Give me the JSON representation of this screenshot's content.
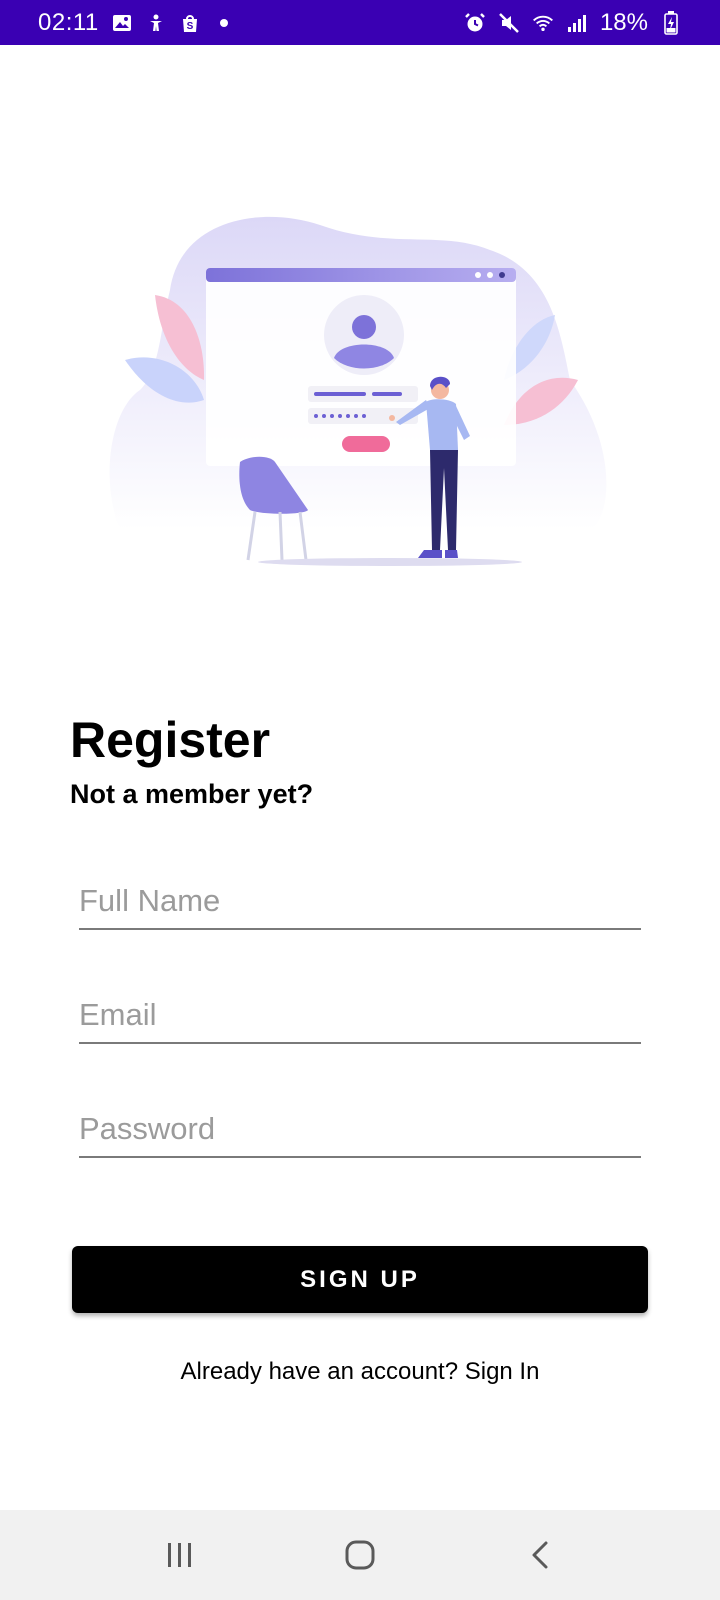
{
  "status_bar": {
    "time": "02:11",
    "battery_percent": "18%",
    "left_icons": [
      "gallery-icon",
      "accessibility-icon",
      "shop-icon",
      "notification-dot-icon"
    ],
    "right_icons": [
      "alarm-icon",
      "mute-icon",
      "wifi-icon",
      "signal-icon",
      "battery-charging-icon"
    ],
    "background_color": "#3a00b3"
  },
  "form": {
    "title": "Register",
    "subtitle": "Not a member yet?",
    "full_name": {
      "placeholder": "Full Name",
      "value": ""
    },
    "email": {
      "placeholder": "Email",
      "value": ""
    },
    "password": {
      "placeholder": "Password",
      "value": ""
    },
    "submit_label": "SIGN UP",
    "signin_prompt": "Already have an account? Sign In"
  },
  "nav_bar": {
    "buttons": [
      "recent-apps-icon",
      "home-icon",
      "back-icon"
    ]
  },
  "colors": {
    "accent_purple": "#7b6fe0",
    "accent_pink": "#f06b9a",
    "button_bg": "#000000"
  }
}
